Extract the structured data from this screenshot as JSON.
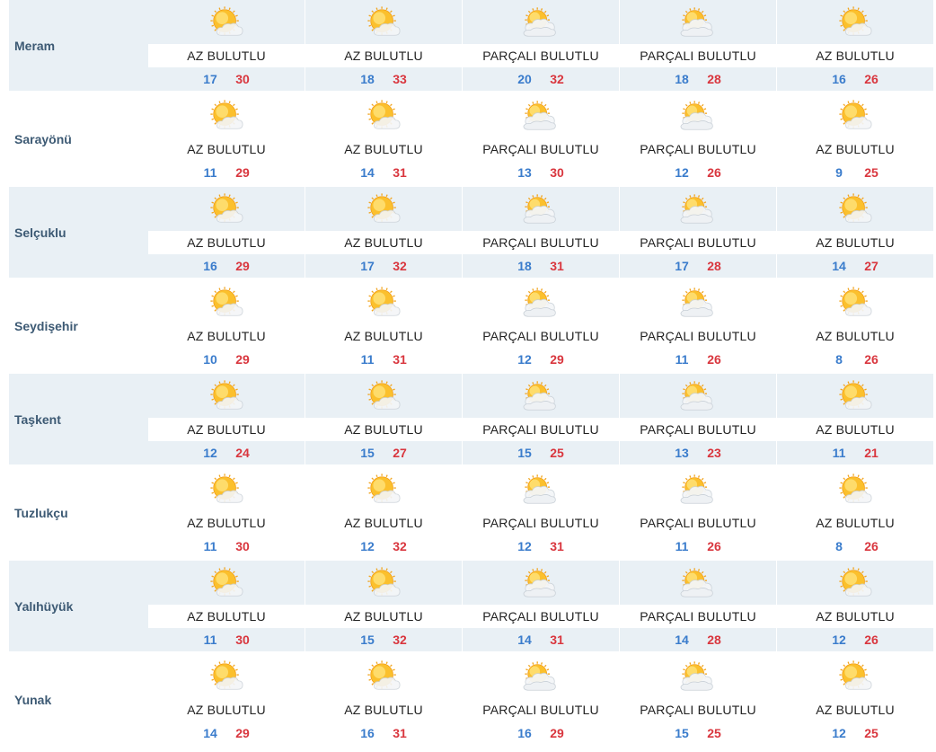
{
  "labels": {
    "az": "AZ BULUTLU",
    "parcali": "PARÇALI BULUTLU"
  },
  "rows": [
    {
      "city": "Meram",
      "days": [
        {
          "cond": "AZ BULUTLU",
          "min": "17",
          "max": "30",
          "icon": "sun-behind-cloud-icon"
        },
        {
          "cond": "AZ BULUTLU",
          "min": "18",
          "max": "33",
          "icon": "sun-behind-cloud-icon"
        },
        {
          "cond": "PARÇALI BULUTLU",
          "min": "20",
          "max": "32",
          "icon": "partly-cloudy-icon"
        },
        {
          "cond": "PARÇALI BULUTLU",
          "min": "18",
          "max": "28",
          "icon": "partly-cloudy-icon"
        },
        {
          "cond": "AZ BULUTLU",
          "min": "16",
          "max": "26",
          "icon": "sun-behind-cloud-icon"
        }
      ]
    },
    {
      "city": "Sarayönü",
      "days": [
        {
          "cond": "AZ BULUTLU",
          "min": "11",
          "max": "29",
          "icon": "sun-behind-cloud-icon"
        },
        {
          "cond": "AZ BULUTLU",
          "min": "14",
          "max": "31",
          "icon": "sun-behind-cloud-icon"
        },
        {
          "cond": "PARÇALI BULUTLU",
          "min": "13",
          "max": "30",
          "icon": "partly-cloudy-icon"
        },
        {
          "cond": "PARÇALI BULUTLU",
          "min": "12",
          "max": "26",
          "icon": "partly-cloudy-icon"
        },
        {
          "cond": "AZ BULUTLU",
          "min": "9",
          "max": "25",
          "icon": "sun-behind-cloud-icon"
        }
      ]
    },
    {
      "city": "Selçuklu",
      "days": [
        {
          "cond": "AZ BULUTLU",
          "min": "16",
          "max": "29",
          "icon": "sun-behind-cloud-icon"
        },
        {
          "cond": "AZ BULUTLU",
          "min": "17",
          "max": "32",
          "icon": "sun-behind-cloud-icon"
        },
        {
          "cond": "PARÇALI BULUTLU",
          "min": "18",
          "max": "31",
          "icon": "partly-cloudy-icon"
        },
        {
          "cond": "PARÇALI BULUTLU",
          "min": "17",
          "max": "28",
          "icon": "partly-cloudy-icon"
        },
        {
          "cond": "AZ BULUTLU",
          "min": "14",
          "max": "27",
          "icon": "sun-behind-cloud-icon"
        }
      ]
    },
    {
      "city": "Seydişehir",
      "days": [
        {
          "cond": "AZ BULUTLU",
          "min": "10",
          "max": "29",
          "icon": "sun-behind-cloud-icon"
        },
        {
          "cond": "AZ BULUTLU",
          "min": "11",
          "max": "31",
          "icon": "sun-behind-cloud-icon"
        },
        {
          "cond": "PARÇALI BULUTLU",
          "min": "12",
          "max": "29",
          "icon": "partly-cloudy-icon"
        },
        {
          "cond": "PARÇALI BULUTLU",
          "min": "11",
          "max": "26",
          "icon": "partly-cloudy-icon"
        },
        {
          "cond": "AZ BULUTLU",
          "min": "8",
          "max": "26",
          "icon": "sun-behind-cloud-icon"
        }
      ]
    },
    {
      "city": "Taşkent",
      "days": [
        {
          "cond": "AZ BULUTLU",
          "min": "12",
          "max": "24",
          "icon": "sun-behind-cloud-icon"
        },
        {
          "cond": "AZ BULUTLU",
          "min": "15",
          "max": "27",
          "icon": "sun-behind-cloud-icon"
        },
        {
          "cond": "PARÇALI BULUTLU",
          "min": "15",
          "max": "25",
          "icon": "partly-cloudy-icon"
        },
        {
          "cond": "PARÇALI BULUTLU",
          "min": "13",
          "max": "23",
          "icon": "partly-cloudy-icon"
        },
        {
          "cond": "AZ BULUTLU",
          "min": "11",
          "max": "21",
          "icon": "sun-behind-cloud-icon"
        }
      ]
    },
    {
      "city": "Tuzlukçu",
      "days": [
        {
          "cond": "AZ BULUTLU",
          "min": "11",
          "max": "30",
          "icon": "sun-behind-cloud-icon"
        },
        {
          "cond": "AZ BULUTLU",
          "min": "12",
          "max": "32",
          "icon": "sun-behind-cloud-icon"
        },
        {
          "cond": "PARÇALI BULUTLU",
          "min": "12",
          "max": "31",
          "icon": "partly-cloudy-icon"
        },
        {
          "cond": "PARÇALI BULUTLU",
          "min": "11",
          "max": "26",
          "icon": "partly-cloudy-icon"
        },
        {
          "cond": "AZ BULUTLU",
          "min": "8",
          "max": "26",
          "icon": "sun-behind-cloud-icon"
        }
      ]
    },
    {
      "city": "Yalıhüyük",
      "days": [
        {
          "cond": "AZ BULUTLU",
          "min": "11",
          "max": "30",
          "icon": "sun-behind-cloud-icon"
        },
        {
          "cond": "AZ BULUTLU",
          "min": "15",
          "max": "32",
          "icon": "sun-behind-cloud-icon"
        },
        {
          "cond": "PARÇALI BULUTLU",
          "min": "14",
          "max": "31",
          "icon": "partly-cloudy-icon"
        },
        {
          "cond": "PARÇALI BULUTLU",
          "min": "14",
          "max": "28",
          "icon": "partly-cloudy-icon"
        },
        {
          "cond": "AZ BULUTLU",
          "min": "12",
          "max": "26",
          "icon": "sun-behind-cloud-icon"
        }
      ]
    },
    {
      "city": "Yunak",
      "days": [
        {
          "cond": "AZ BULUTLU",
          "min": "14",
          "max": "29",
          "icon": "sun-behind-cloud-icon"
        },
        {
          "cond": "AZ BULUTLU",
          "min": "16",
          "max": "31",
          "icon": "sun-behind-cloud-icon"
        },
        {
          "cond": "PARÇALI BULUTLU",
          "min": "16",
          "max": "29",
          "icon": "partly-cloudy-icon"
        },
        {
          "cond": "PARÇALI BULUTLU",
          "min": "15",
          "max": "25",
          "icon": "partly-cloudy-icon"
        },
        {
          "cond": "AZ BULUTLU",
          "min": "12",
          "max": "25",
          "icon": "sun-behind-cloud-icon"
        }
      ]
    }
  ],
  "colors": {
    "shade": "#e9f0f5",
    "city_text": "#3d5a74",
    "min_temp": "#3a7ccc",
    "max_temp": "#d9363e"
  }
}
